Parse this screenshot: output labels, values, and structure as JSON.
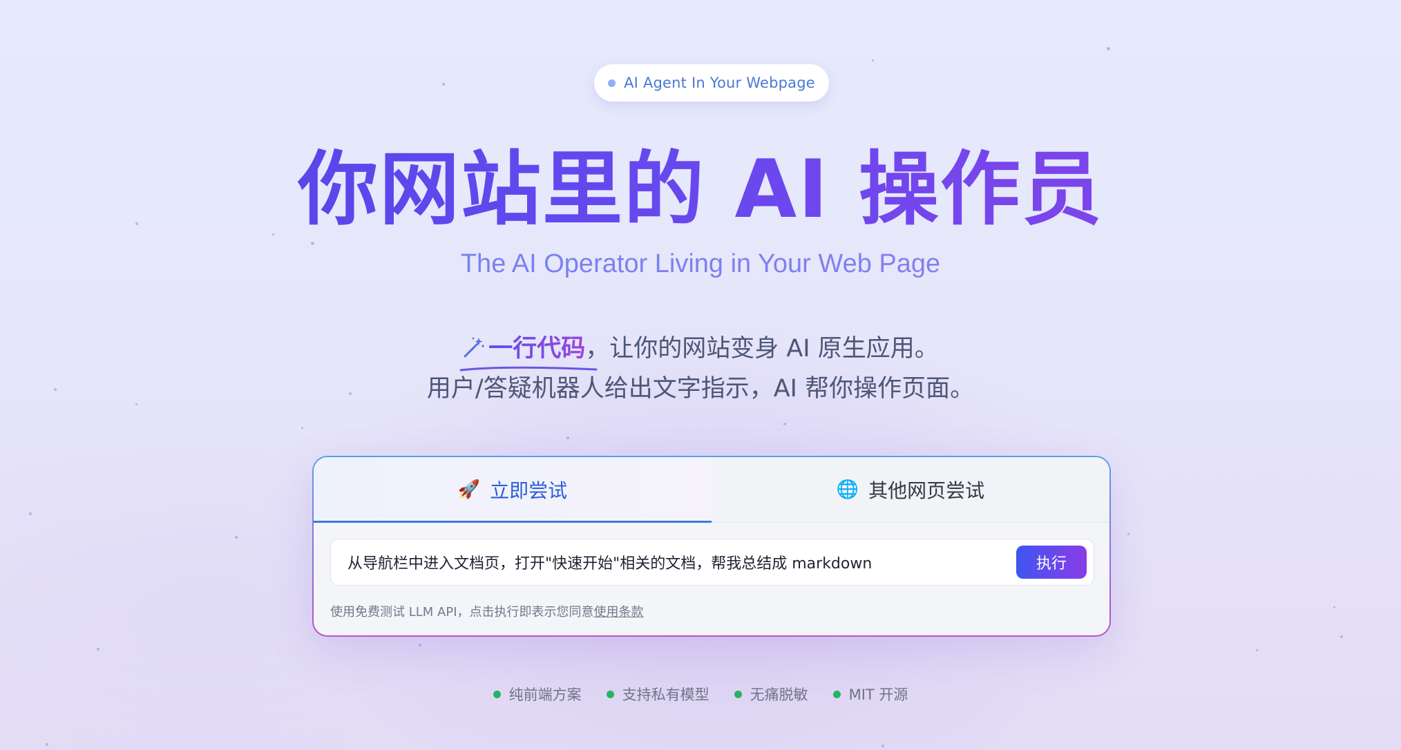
{
  "badge": {
    "label": "AI Agent In Your Webpage"
  },
  "hero": {
    "title": "你网站里的 AI 操作员",
    "subtitle": "The AI Operator Living in Your Web Page"
  },
  "description": {
    "highlight": "一行代码",
    "line1_rest": "，让你的网站变身 AI 原生应用。",
    "line2": "用户/答疑机器人给出文字指示，AI 帮你操作页面。"
  },
  "card": {
    "tabs": [
      {
        "label": "立即尝试",
        "icon": "rocket-icon",
        "active": true
      },
      {
        "label": "其他网页尝试",
        "icon": "globe-icon",
        "active": false
      }
    ],
    "task_input_value": "从导航栏中进入文档页，打开\"快速开始\"相关的文档，帮我总结成 markdown",
    "run_button": "执行",
    "footnote_prefix": "使用免费测试 LLM API，点击执行即表示您同意",
    "footnote_link": "使用条款"
  },
  "features": [
    "纯前端方案",
    "支持私有模型",
    "无痛脱敏",
    "MIT 开源"
  ],
  "colors": {
    "accent_blue": "#3d78de",
    "title_gradient_start": "#4e46e5",
    "title_gradient_end": "#8a43e8",
    "feature_dot": "#27b362"
  }
}
